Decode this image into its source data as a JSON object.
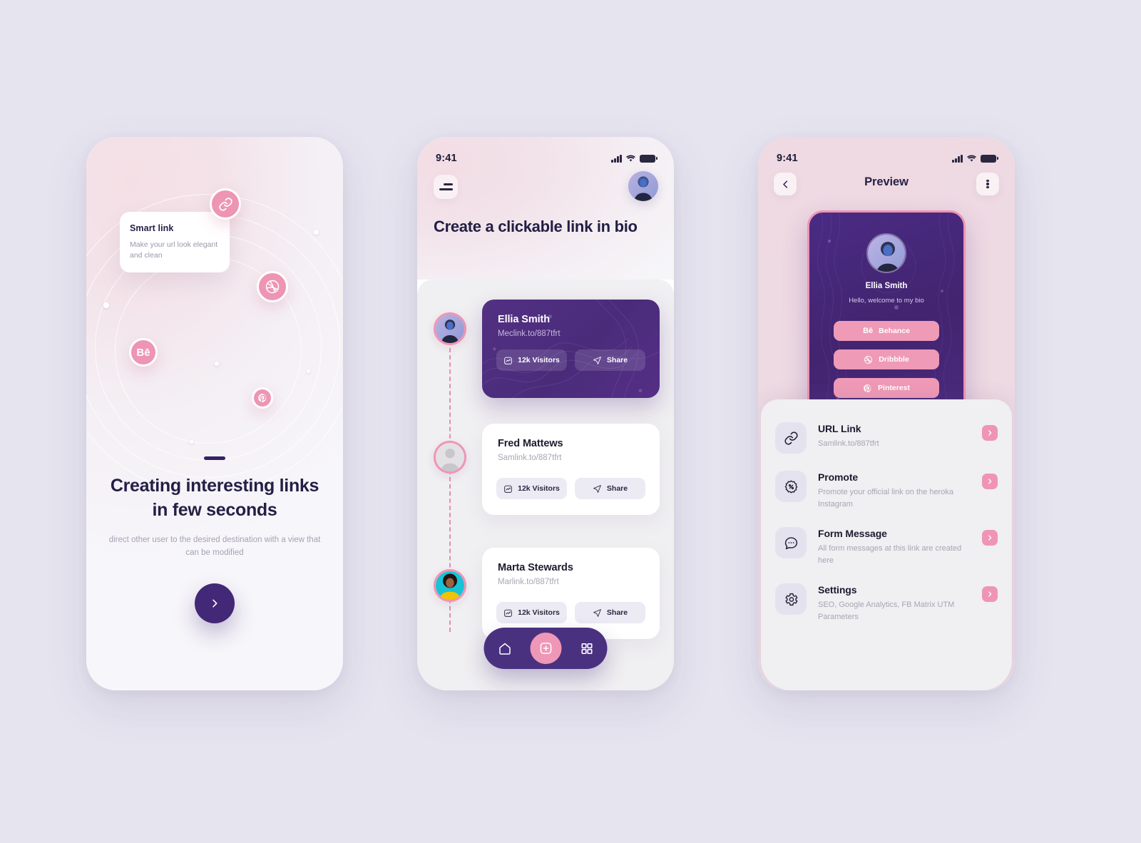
{
  "page": {
    "background_color": "#e6e4ef",
    "accent_pink": "#ef95b4",
    "accent_purple": "#4a2b7a",
    "ink": "#231f45"
  },
  "phone1": {
    "tooltip": {
      "title": "Smart link",
      "text": "Make your url look elegant and clean"
    },
    "bubbles": [
      {
        "name": "link-icon",
        "label": ""
      },
      {
        "name": "dribbble-icon",
        "label": ""
      },
      {
        "name": "behance-icon",
        "label": "Bē"
      },
      {
        "name": "pinterest-icon",
        "label": ""
      }
    ],
    "headline": "Creating interesting links in few seconds",
    "subtext": "direct other user to the desired destination with a view that can be modified",
    "next_label": "next"
  },
  "phone2": {
    "status": {
      "time": "9:41"
    },
    "filter_label": "filter",
    "title": "Create a clickable link in bio",
    "cards": [
      {
        "name": "Ellia Smith",
        "url": "Meclink.to/887tfrt",
        "visitors": "12k Visitors",
        "share": "Share",
        "theme": "dark"
      },
      {
        "name": "Fred Mattews",
        "url": "Samlink.to/887tfrt",
        "visitors": "12k Visitors",
        "share": "Share",
        "theme": "light"
      },
      {
        "name": "Marta Stewards",
        "url": "Marlink.to/887tfrt",
        "visitors": "12k Visitors",
        "share": "Share",
        "theme": "light"
      }
    ],
    "nav": [
      {
        "name": "home-icon",
        "label": "Home"
      },
      {
        "name": "plus-icon",
        "label": "Add"
      },
      {
        "name": "grid-icon",
        "label": "Apps"
      }
    ]
  },
  "phone3": {
    "status": {
      "time": "9:41"
    },
    "title": "Preview",
    "back_label": "Back",
    "more_label": "More options",
    "profile": {
      "name": "Ellia Smith",
      "bio": "Hello, welcome to my bio",
      "links": [
        {
          "label": "Behance",
          "icon": "behance-icon",
          "glyph": "Bē"
        },
        {
          "label": "Dribbble",
          "icon": "dribbble-icon",
          "glyph": ""
        },
        {
          "label": "Pinterest",
          "icon": "pinterest-icon",
          "glyph": ""
        }
      ]
    },
    "menu": [
      {
        "icon": "link-icon",
        "title": "URL Link",
        "subtitle": "Samlink.to/887tfrt"
      },
      {
        "icon": "percent-badge-icon",
        "title": "Promote",
        "subtitle": "Promote your official link on the heroka Instagram"
      },
      {
        "icon": "chat-bubble-icon",
        "title": "Form Message",
        "subtitle": "All form messages at this link are created here"
      },
      {
        "icon": "gear-icon",
        "title": "Settings",
        "subtitle": "SEO, Google Analytics, FB Matrix UTM Parameters"
      }
    ]
  }
}
